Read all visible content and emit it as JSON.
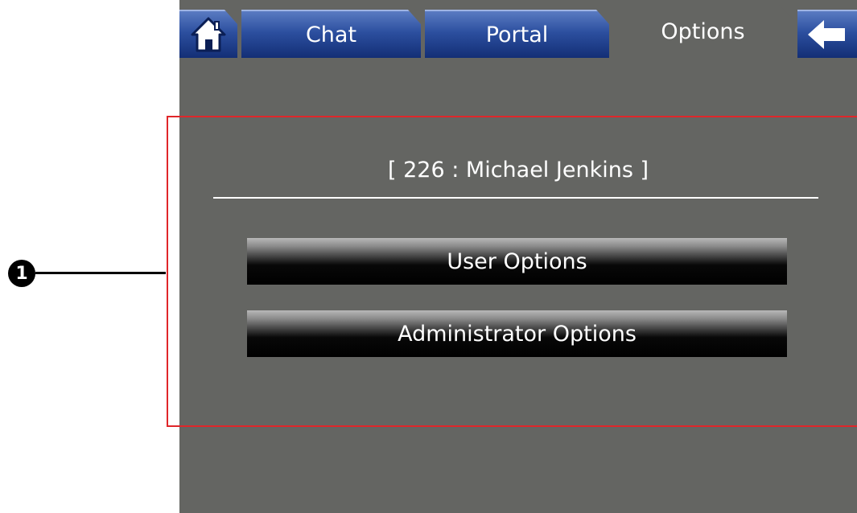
{
  "tabs": {
    "home_icon": "house-icon",
    "chat_label": "Chat",
    "portal_label": "Portal",
    "options_label": "Options",
    "back_icon": "arrow-left-icon"
  },
  "main": {
    "user_label": "[ 226 : Michael Jenkins ]",
    "user_options_label": "User Options",
    "admin_options_label": "Administrator Options"
  },
  "callout": {
    "marker": "1"
  },
  "colors": {
    "screen_background": "#646562",
    "tab_blue": "#2c4f9f",
    "highlight_border": "#e0262a"
  }
}
